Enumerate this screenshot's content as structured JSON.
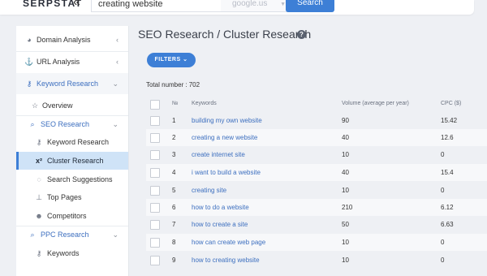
{
  "header": {
    "logo": "SERPSTAT",
    "collapse_glyph": "«",
    "search_value": "creating website",
    "region": "google.us",
    "search_button": "Search"
  },
  "sidebar": {
    "items": [
      {
        "label": "Domain Analysis",
        "icon": "pie-chart-icon"
      },
      {
        "label": "URL Analysis",
        "icon": "anchor-icon"
      },
      {
        "label": "Keyword Research",
        "icon": "key-icon"
      },
      {
        "label": "Overview",
        "icon": "star-icon"
      },
      {
        "label": "SEO Research",
        "icon": "search-icon"
      },
      {
        "label": "Keyword Research",
        "icon": "key-icon"
      },
      {
        "label": "Cluster Research",
        "icon": "x-squared-icon"
      },
      {
        "label": "Search Suggestions",
        "icon": "chat-icon"
      },
      {
        "label": "Top Pages",
        "icon": "sitemap-icon"
      },
      {
        "label": "Competitors",
        "icon": "users-icon"
      },
      {
        "label": "PPC Research",
        "icon": "search-icon"
      },
      {
        "label": "Keywords",
        "icon": "key-icon"
      }
    ]
  },
  "main": {
    "title": "SEO Research / Cluster Research",
    "filters_label": "FILTERS",
    "total_label": "Total number :",
    "total_value": "702",
    "columns": {
      "no": "№",
      "keywords": "Keywords",
      "volume": "Volume (average per year)",
      "cpc": "CPC ($)"
    },
    "rows": [
      {
        "n": "1",
        "keyword": "building my own website",
        "volume": "90",
        "cpc": "15.42"
      },
      {
        "n": "2",
        "keyword": "creating a new website",
        "volume": "40",
        "cpc": "12.6"
      },
      {
        "n": "3",
        "keyword": "create internet site",
        "volume": "10",
        "cpc": "0"
      },
      {
        "n": "4",
        "keyword": "i want to build a website",
        "volume": "40",
        "cpc": "15.4"
      },
      {
        "n": "5",
        "keyword": "creating site",
        "volume": "10",
        "cpc": "0"
      },
      {
        "n": "6",
        "keyword": "how to do a website",
        "volume": "210",
        "cpc": "6.12"
      },
      {
        "n": "7",
        "keyword": "how to create a site",
        "volume": "50",
        "cpc": "6.63"
      },
      {
        "n": "8",
        "keyword": "how can create web page",
        "volume": "10",
        "cpc": "0"
      },
      {
        "n": "9",
        "keyword": "how to creating website",
        "volume": "10",
        "cpc": "0"
      }
    ]
  },
  "colors": {
    "accent": "#3d7fd6",
    "link": "#3d6fbf",
    "active_bg": "#cfe3f7"
  }
}
